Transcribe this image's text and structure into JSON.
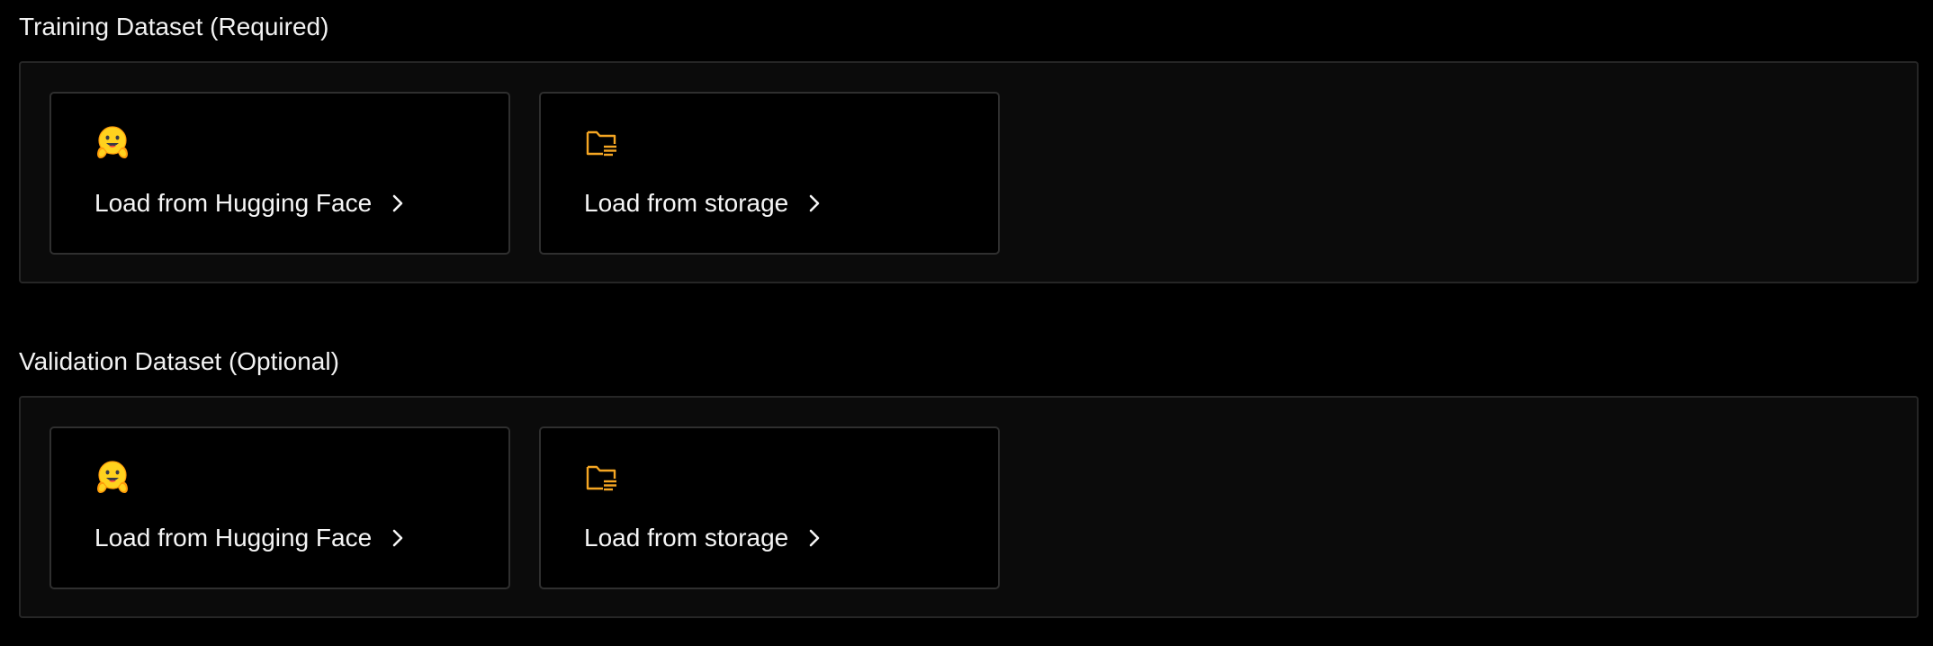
{
  "colors": {
    "background": "#000000",
    "panel": "#0b0b0b",
    "panel_border": "#262626",
    "card_border": "#2f2f2f",
    "folder_icon": "#f5a623",
    "text": "#f5f5f5"
  },
  "training": {
    "title": "Training Dataset (Required)",
    "options": [
      {
        "label": "Load from Hugging Face",
        "icon": "hugging-face-icon"
      },
      {
        "label": "Load from storage",
        "icon": "folder-icon"
      }
    ]
  },
  "validation": {
    "title": "Validation Dataset (Optional)",
    "options": [
      {
        "label": "Load from Hugging Face",
        "icon": "hugging-face-icon"
      },
      {
        "label": "Load from storage",
        "icon": "folder-icon"
      }
    ]
  }
}
